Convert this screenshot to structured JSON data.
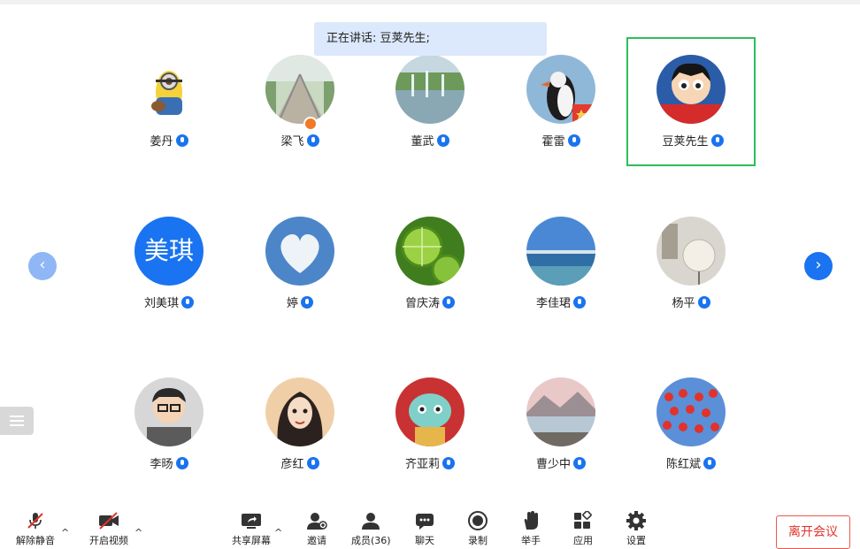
{
  "speaking_banner": "正在讲话: 豆荚先生;",
  "participants": [
    {
      "name": "姜丹",
      "avatar": "minion-icon"
    },
    {
      "name": "梁飞",
      "avatar": "bridge-photo"
    },
    {
      "name": "董武",
      "avatar": "fountain-photo"
    },
    {
      "name": "霍雷",
      "avatar": "puffin-photo"
    },
    {
      "name": "豆荚先生",
      "avatar": "astroboy-photo",
      "active": true
    },
    {
      "name": "刘美琪",
      "avatar_text": "美琪"
    },
    {
      "name": "婷",
      "avatar": "heart-cloud-photo"
    },
    {
      "name": "曾庆涛",
      "avatar": "lime-photo"
    },
    {
      "name": "李佳珺",
      "avatar": "sea-photo"
    },
    {
      "name": "杨平",
      "avatar": "dandelion-photo"
    },
    {
      "name": "李旸",
      "avatar": "cartoon-man-photo"
    },
    {
      "name": "彦红",
      "avatar": "cartoon-woman-photo"
    },
    {
      "name": "齐亚莉",
      "avatar": "tiger-photo"
    },
    {
      "name": "曹少中",
      "avatar": "lake-photo"
    },
    {
      "name": "陈红斌",
      "avatar": "lanterns-photo"
    }
  ],
  "toolbar": {
    "unmute": "解除静音",
    "start_video": "开启视频",
    "share_screen": "共享屏幕",
    "invite": "邀请",
    "members": "成员(36)",
    "chat": "聊天",
    "record": "录制",
    "raise_hand": "举手",
    "apps": "应用",
    "settings": "设置",
    "leave": "离开会议"
  },
  "colors": {
    "accent": "#1a73f0",
    "active_border": "#2dbe5a",
    "leave": "#e0342a",
    "banner": "#dce8fb"
  }
}
